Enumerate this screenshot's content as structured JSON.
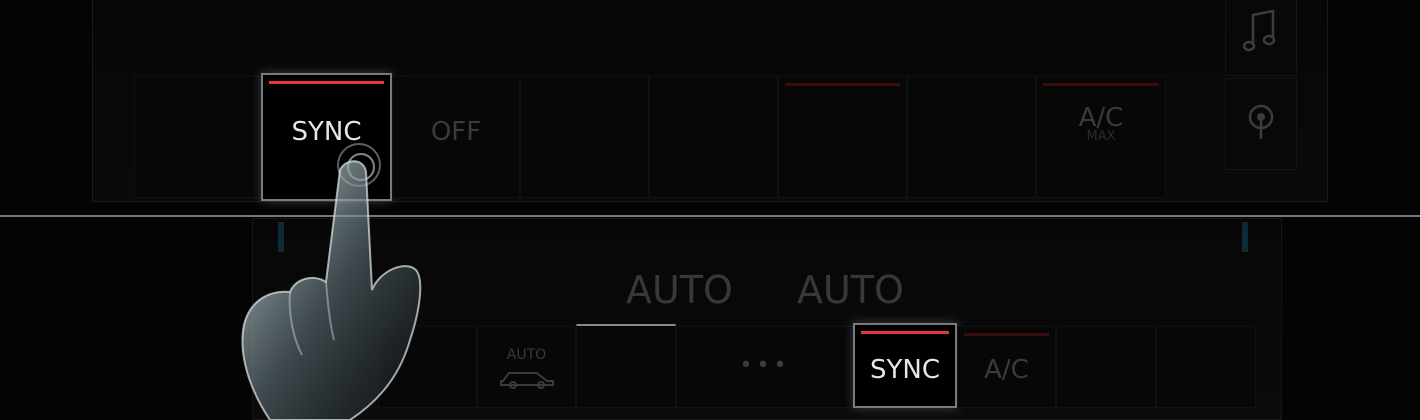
{
  "top_panel": {
    "buttons": [
      {
        "label": "",
        "sub": ""
      },
      {
        "label": "SYNC",
        "sub": ""
      },
      {
        "label": "OFF",
        "sub": ""
      },
      {
        "label": "",
        "sub": ""
      },
      {
        "label": "",
        "sub": ""
      },
      {
        "label": "",
        "sub": ""
      },
      {
        "label": "",
        "sub": ""
      },
      {
        "label": "A/C",
        "sub": "MAX"
      }
    ]
  },
  "side_icons": [
    "music-note-icon",
    "navigation-pin-icon"
  ],
  "bottom_panel": {
    "auto_left": "AUTO",
    "auto_right": "AUTO",
    "buttons": [
      {
        "label": "",
        "sub": ""
      },
      {
        "label": "",
        "sub": "AUTO"
      },
      {
        "label": "",
        "sub": ""
      },
      {
        "label": "•••",
        "sub": ""
      },
      {
        "label": "SYNC",
        "sub": ""
      },
      {
        "label": "A/C",
        "sub": ""
      },
      {
        "label": "",
        "sub": ""
      },
      {
        "label": "",
        "sub": ""
      }
    ]
  },
  "colors": {
    "active_accent": "#e63a3a",
    "inactive_accent": "#3a0d0d",
    "active_text": "#e6e6e6",
    "inactive_text": "#3a3a3a"
  }
}
